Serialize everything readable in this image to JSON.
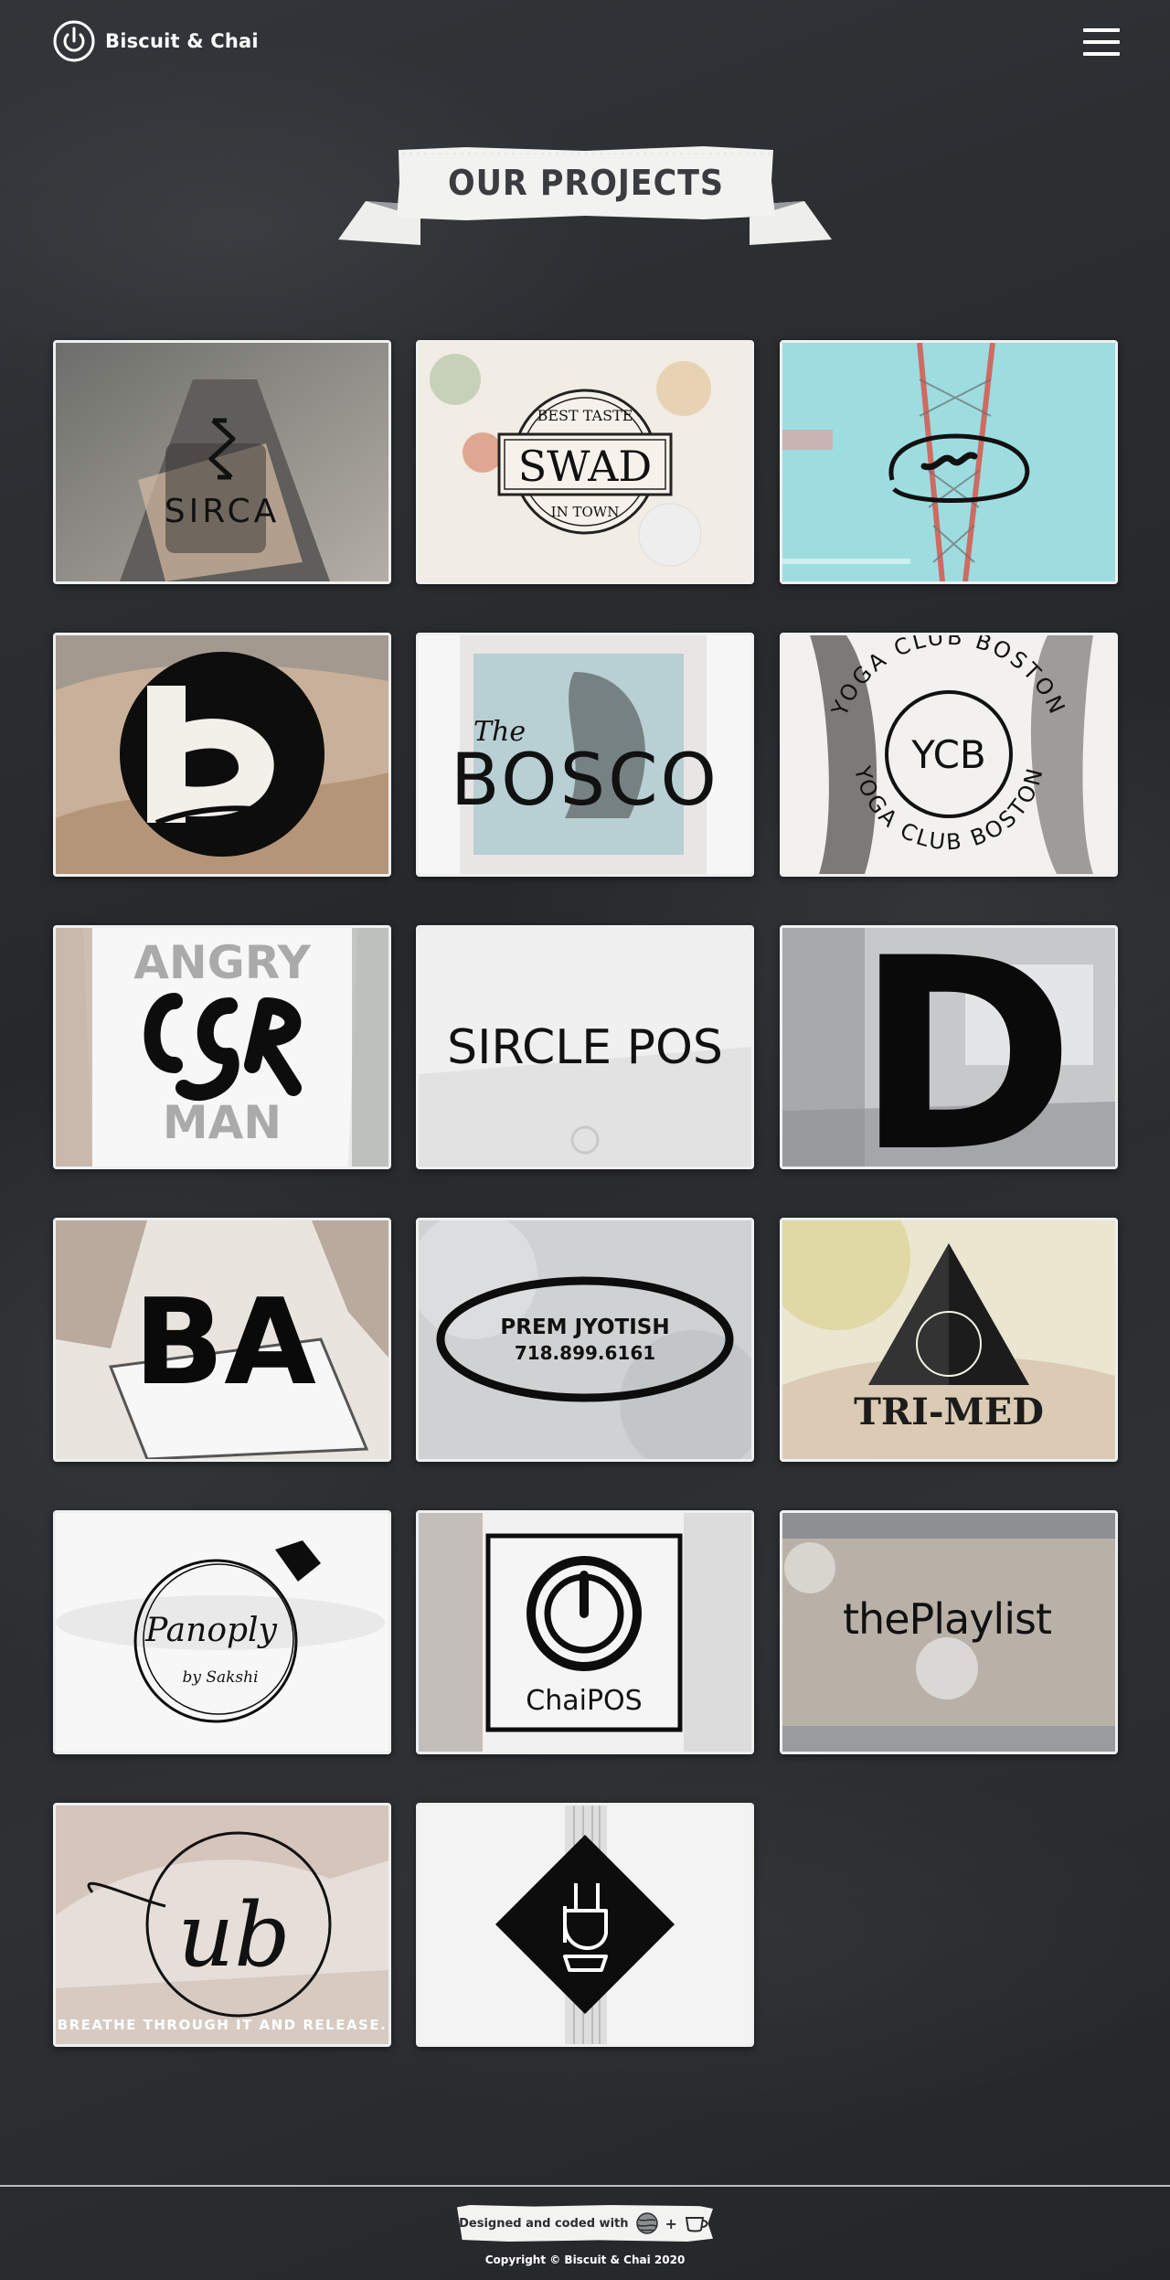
{
  "nav": {
    "brand_name": "Biscuit & Chai",
    "logo_icon": "power-icon",
    "menu_icon": "hamburger-menu-icon"
  },
  "banner": {
    "title": "OUR PROJECTS"
  },
  "projects": [
    {
      "logo_text": "SIRCA",
      "theme": "#8f8d88"
    },
    {
      "logo_text": "SWAD",
      "arc_top": "BEST TASTE",
      "arc_bottom": "IN TOWN",
      "theme": "#f1ece4"
    },
    {
      "logo_text": "",
      "theme": "#9ddde0"
    },
    {
      "logo_text": "",
      "theme": "#c9b09a"
    },
    {
      "logo_text": "BOSCO",
      "script_text": "The",
      "theme": "#f6f6f6"
    },
    {
      "logo_text": "YCB",
      "arc_top": "YOGA CLUB BOSTON",
      "arc_bottom": "YOGA CLUB BOSTON",
      "theme": "#f3f1ef"
    },
    {
      "logo_text": "ANGRY",
      "logo_text_2": "MAN",
      "theme": "#e9e9e9"
    },
    {
      "logo_text": "SIRCLE POS",
      "theme": "#f0f0f0"
    },
    {
      "logo_text": "D",
      "theme": "#c7c8ca"
    },
    {
      "logo_text": "BA",
      "theme": "#e9e4de"
    },
    {
      "logo_text": "PREM JYOTISH",
      "logo_text_2": "718.899.6161",
      "theme": "#cfd1d3"
    },
    {
      "logo_text": "TRI-MED",
      "theme": "#ebe6d0"
    },
    {
      "logo_text": "Panoply",
      "logo_text_2": "by Sakshi",
      "theme": "#f7f7f7"
    },
    {
      "logo_text": "ChaiPOS",
      "theme": "#f1f1f1"
    },
    {
      "logo_text": "thePlaylist",
      "theme": "#c8c3c0"
    },
    {
      "logo_text": "ub",
      "logo_text_2": "BREATHE THROUGH IT AND RELEASE.",
      "theme": "#e6ded8"
    },
    {
      "logo_text": "",
      "theme": "#f3f3f3"
    }
  ],
  "footer": {
    "credit_label": "Designed and coded with",
    "credit_icon_1": "globe-icon",
    "credit_plus": "+",
    "credit_icon_2": "tea-cup-icon",
    "copyright": "Copyright ©  Biscuit & Chai 2020"
  }
}
